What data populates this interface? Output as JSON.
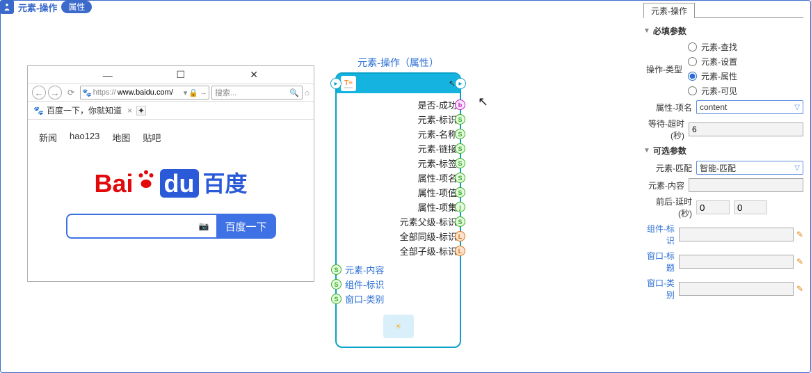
{
  "topbar": {
    "title": "元素-操作",
    "badge": "属性"
  },
  "browser": {
    "url_prefix": "https://",
    "url": "www.baidu.com/",
    "search_placeholder": "搜索...",
    "tab_title": "百度一下，你就知道",
    "tab_close": "×",
    "links": [
      "新闻",
      "hao123",
      "地图",
      "贴吧"
    ],
    "logo": {
      "bai": "Bai",
      "du": "du",
      "zh": "百度"
    },
    "search_btn": "百度一下",
    "win": {
      "min": "—",
      "max": "☐",
      "close": "✕"
    }
  },
  "node": {
    "title": "元素-操作（属性）",
    "outputs": [
      {
        "label": "是否-成功",
        "pin": "b",
        "cls": "pin-b"
      },
      {
        "label": "元素-标识",
        "pin": "S",
        "cls": "pin-s"
      },
      {
        "label": "元素-名称",
        "pin": "S",
        "cls": "pin-s"
      },
      {
        "label": "元素-链接",
        "pin": "S",
        "cls": "pin-s"
      },
      {
        "label": "元素-标签",
        "pin": "S",
        "cls": "pin-s"
      },
      {
        "label": "属性-项名",
        "pin": "S",
        "cls": "pin-s"
      },
      {
        "label": "属性-项值",
        "pin": "S",
        "cls": "pin-s"
      },
      {
        "label": "属性-项集",
        "pin": "j",
        "cls": "pin-j"
      },
      {
        "label": "元素父级-标识",
        "pin": "S",
        "cls": "pin-s"
      },
      {
        "label": "全部同级-标识",
        "pin": "L",
        "cls": "pin-l"
      },
      {
        "label": "全部子级-标识",
        "pin": "L",
        "cls": "pin-l"
      }
    ],
    "inputs": [
      {
        "label": "元素-内容",
        "pin": "S"
      },
      {
        "label": "组件-标识",
        "pin": "S"
      },
      {
        "label": "窗口-类别",
        "pin": "S"
      }
    ]
  },
  "panel": {
    "tab": "元素-操作",
    "required_header": "必填参数",
    "optional_header": "可选参数",
    "op_type_label": "操作-类型",
    "op_types": [
      "元素-查找",
      "元素-设置",
      "元素-属性",
      "元素-可见"
    ],
    "op_selected": "元素-属性",
    "attr_name_label": "属性-项名",
    "attr_name_value": "content",
    "wait_label": "等待-超时(秒)",
    "wait_value": "6",
    "match_label": "元素-匹配",
    "match_value": "智能-匹配",
    "content_label": "元素-内容",
    "content_value": "",
    "delay_label": "前后-延时(秒)",
    "delay_before": "0",
    "delay_after": "0",
    "comp_id_label": "组件-标识",
    "comp_id_value": "",
    "win_title_label": "窗口-标题",
    "win_title_value": "",
    "win_class_label": "窗口-类别",
    "win_class_value": ""
  }
}
